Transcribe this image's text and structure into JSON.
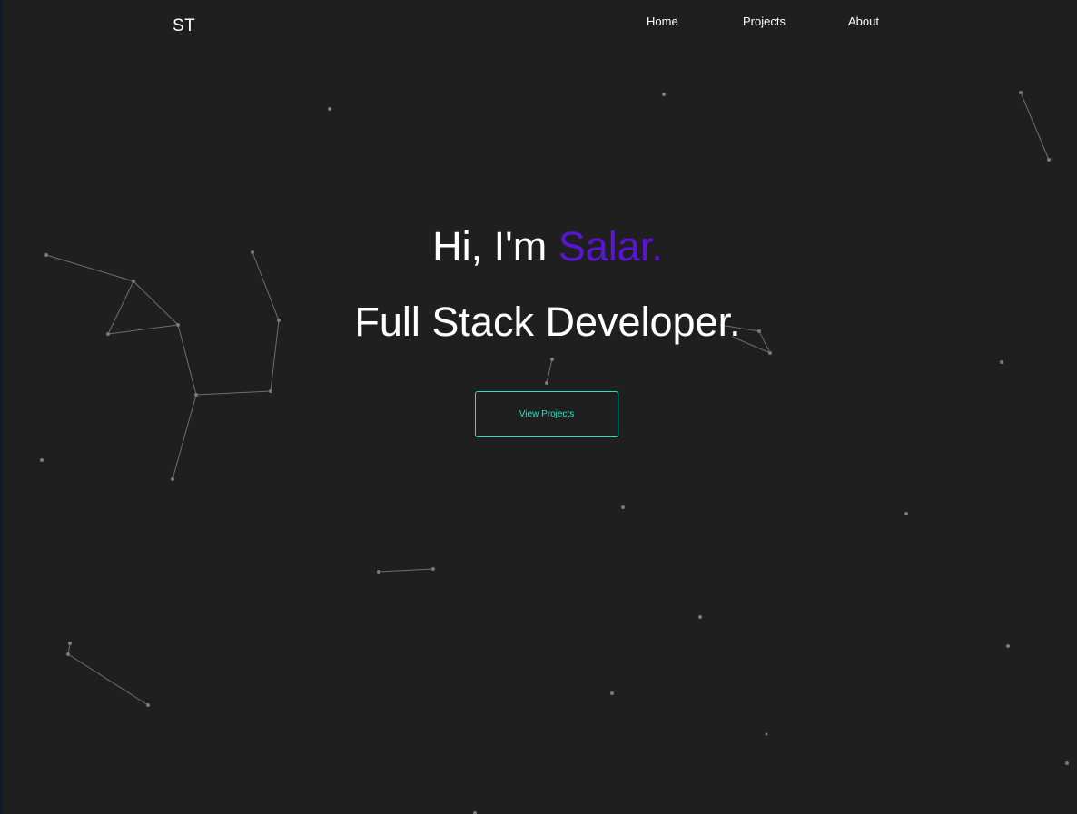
{
  "nav": {
    "logo": "ST",
    "links": {
      "home": "Home",
      "projects": "Projects",
      "about": "About"
    }
  },
  "hero": {
    "greeting": "Hi, I'm ",
    "name": "Salar.",
    "title": "Full Stack Developer.",
    "cta_label": "View Projects"
  },
  "colors": {
    "background": "#1f1f1f",
    "accent_name": "#5b14d6",
    "accent_button": "#1de9c6",
    "text": "#ffffff"
  }
}
